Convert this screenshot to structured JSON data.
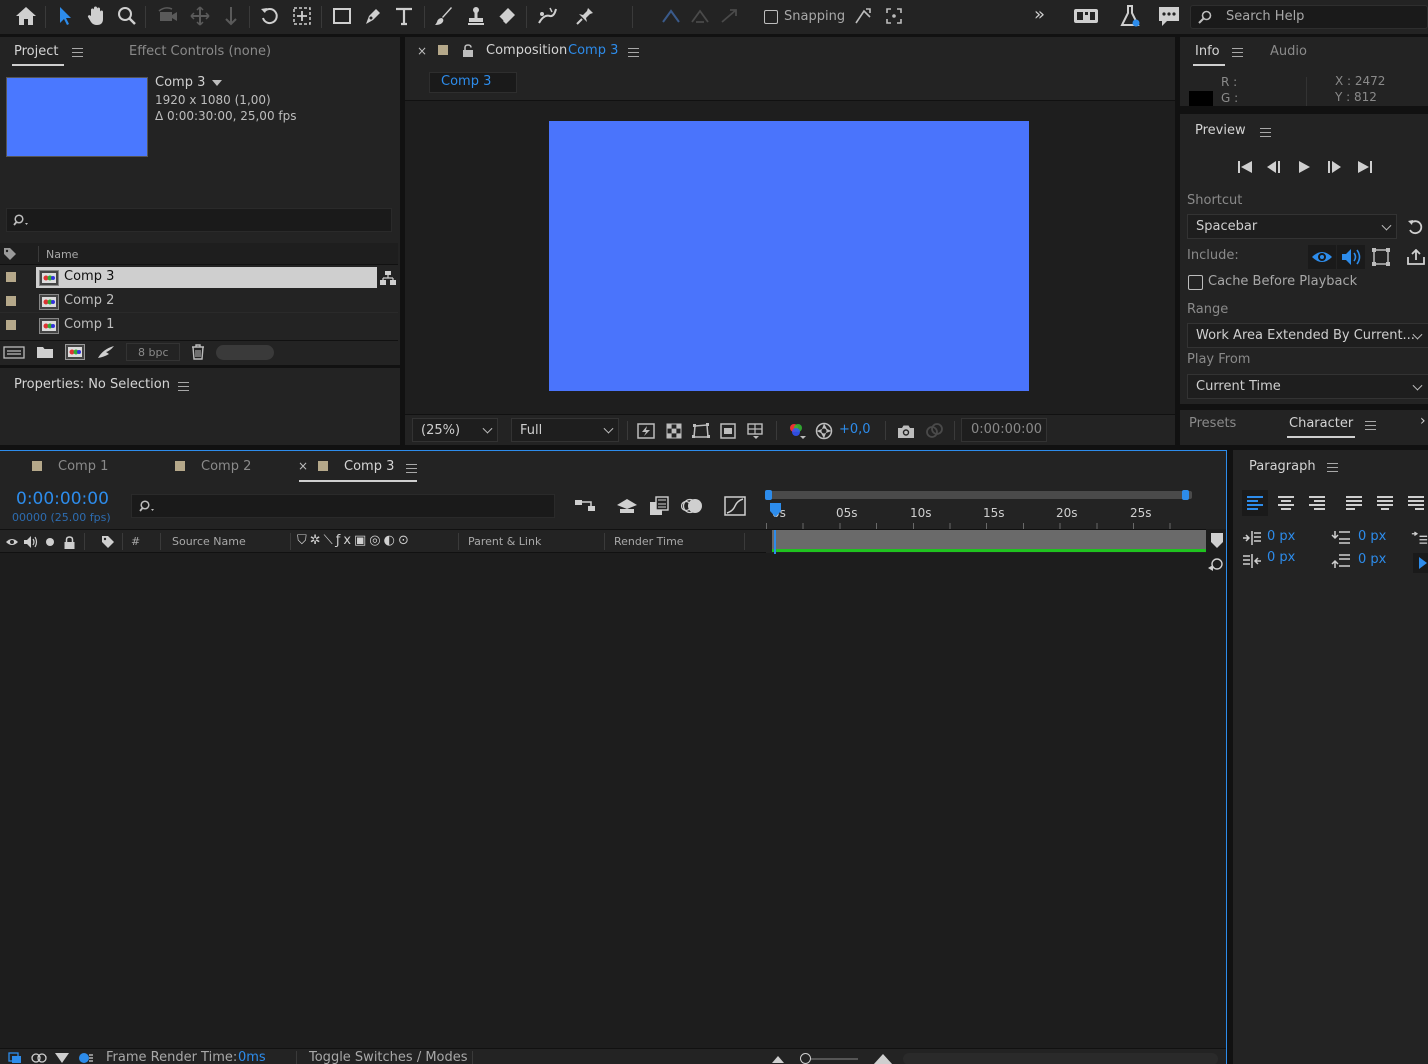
{
  "toolbar": {
    "snapping_label": "Snapping",
    "search_placeholder": "Search Help"
  },
  "project_panel": {
    "tab_project": "Project",
    "tab_effect_controls": "Effect Controls (none)",
    "selected_comp": {
      "name": "Comp 3",
      "resolution": "1920 x 1080 (1,00)",
      "duration": "Δ 0:00:30:00, 25,00 fps",
      "thumb_color": "#4a78ff"
    },
    "column_name": "Name",
    "items": [
      {
        "name": "Comp 3",
        "selected": true
      },
      {
        "name": "Comp 2",
        "selected": false
      },
      {
        "name": "Comp 1",
        "selected": false
      }
    ],
    "bpc_label": "8 bpc"
  },
  "properties_panel": {
    "title": "Properties: No Selection"
  },
  "composition_panel": {
    "title_prefix": "Composition",
    "title_comp": "Comp 3",
    "sub_tab": "Comp 3",
    "canvas_color": "#4a74fc",
    "zoom": "(25%)",
    "resolution": "Full",
    "exposure": "+0,0",
    "timecode": "0:00:00:00"
  },
  "info_panel": {
    "tab_info": "Info",
    "tab_audio": "Audio",
    "r_label": "R :",
    "g_label": "G :",
    "x_readout": "X : 2472",
    "y_readout": "Y : 812"
  },
  "preview_panel": {
    "title": "Preview",
    "shortcut_label": "Shortcut",
    "shortcut_value": "Spacebar",
    "include_label": "Include:",
    "cache_label": "Cache Before Playback",
    "range_label": "Range",
    "range_value": "Work Area Extended By Current...",
    "play_from_label": "Play From",
    "play_from_value": "Current Time"
  },
  "char_panel": {
    "tab_presets": "Presets",
    "tab_character": "Character"
  },
  "paragraph_panel": {
    "title": "Paragraph",
    "indent_left": "0 px",
    "indent_right": "0 px",
    "space_before": "0 px",
    "space_after": "0 px"
  },
  "timeline": {
    "tabs": [
      {
        "name": "Comp 1",
        "active": false
      },
      {
        "name": "Comp 2",
        "active": false
      },
      {
        "name": "Comp 3",
        "active": true
      }
    ],
    "timecode": "0:00:00:00",
    "frame_info": "00000 (25.00 fps)",
    "col_number": "#",
    "col_source_name": "Source Name",
    "col_parent": "Parent & Link",
    "col_render_time": "Render Time",
    "ruler_labels": [
      "0s",
      "05s",
      "10s",
      "15s",
      "20s",
      "25s"
    ]
  },
  "status_bar": {
    "frame_render_label": "Frame Render Time:",
    "frame_render_value": "0ms",
    "toggle_label": "Toggle Switches / Modes"
  },
  "colors": {
    "accent": "#2d8ceb",
    "label_tan": "#b5a88a",
    "workarea_green": "#1fc31f"
  }
}
